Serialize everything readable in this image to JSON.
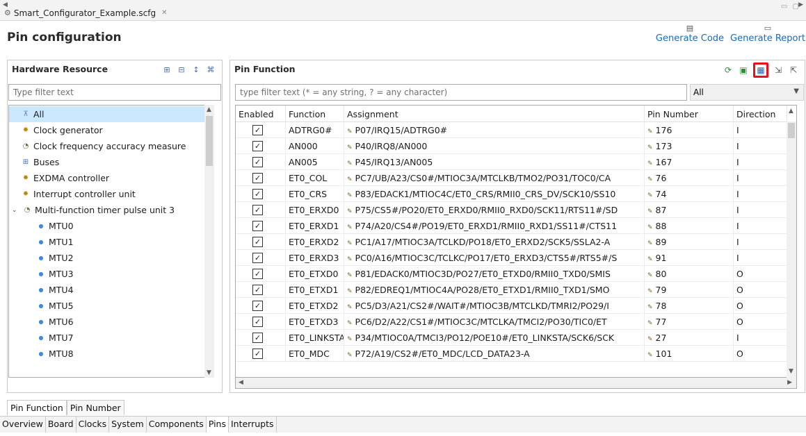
{
  "editor_tab": {
    "title": "Smart_Configurator_Example.scfg",
    "close": "✕"
  },
  "header": {
    "title": "Pin configuration",
    "generate_code": "Generate Code",
    "generate_report": "Generate Report"
  },
  "hardware_resource": {
    "title": "Hardware Resource",
    "filter_placeholder": "Type filter text",
    "items": [
      {
        "label": "All",
        "icon": "all-icon",
        "indent": 0,
        "selected": true
      },
      {
        "label": "Clock generator",
        "icon": "gear-icon",
        "indent": 0
      },
      {
        "label": "Clock frequency accuracy measure",
        "icon": "clock-icon",
        "indent": 0
      },
      {
        "label": "Buses",
        "icon": "bus-icon",
        "indent": 0
      },
      {
        "label": "EXDMA controller",
        "icon": "gear-icon",
        "indent": 0
      },
      {
        "label": "Interrupt controller unit",
        "icon": "gear-icon",
        "indent": 0
      },
      {
        "label": "Multi-function timer pulse unit 3",
        "icon": "clock-icon",
        "indent": 0,
        "expanded": true
      },
      {
        "label": "MTU0",
        "icon": "dot-icon",
        "indent": 1
      },
      {
        "label": "MTU1",
        "icon": "dot-icon",
        "indent": 1
      },
      {
        "label": "MTU2",
        "icon": "dot-icon",
        "indent": 1
      },
      {
        "label": "MTU3",
        "icon": "dot-icon",
        "indent": 1
      },
      {
        "label": "MTU4",
        "icon": "dot-icon",
        "indent": 1
      },
      {
        "label": "MTU5",
        "icon": "dot-icon",
        "indent": 1
      },
      {
        "label": "MTU6",
        "icon": "dot-icon",
        "indent": 1
      },
      {
        "label": "MTU7",
        "icon": "dot-icon",
        "indent": 1
      },
      {
        "label": "MTU8",
        "icon": "dot-icon",
        "indent": 1
      }
    ]
  },
  "pin_function": {
    "title": "Pin Function",
    "filter_placeholder": "type filter text (* = any string, ? = any character)",
    "select_value": "All",
    "columns": [
      "Enabled",
      "Function",
      "Assignment",
      "Pin Number",
      "Direction"
    ],
    "rows": [
      {
        "function": "ADTRG0#",
        "assignment": "P07/IRQ15/ADTRG0#",
        "pin": "176",
        "dir": "I"
      },
      {
        "function": "AN000",
        "assignment": "P40/IRQ8/AN000",
        "pin": "173",
        "dir": "I"
      },
      {
        "function": "AN005",
        "assignment": "P45/IRQ13/AN005",
        "pin": "167",
        "dir": "I"
      },
      {
        "function": "ET0_COL",
        "assignment": "PC7/UB/A23/CS0#/MTIOC3A/MTCLKB/TMO2/PO31/TOC0/CA",
        "pin": "76",
        "dir": "I"
      },
      {
        "function": "ET0_CRS",
        "assignment": "P83/EDACK1/MTIOC4C/ET0_CRS/RMII0_CRS_DV/SCK10/SS10",
        "pin": "74",
        "dir": "I"
      },
      {
        "function": "ET0_ERXD0",
        "assignment": "P75/CS5#/PO20/ET0_ERXD0/RMII0_RXD0/SCK11/RTS11#/SD",
        "pin": "87",
        "dir": "I"
      },
      {
        "function": "ET0_ERXD1",
        "assignment": "P74/A20/CS4#/PO19/ET0_ERXD1/RMII0_RXD1/SS11#/CTS11",
        "pin": "88",
        "dir": "I"
      },
      {
        "function": "ET0_ERXD2",
        "assignment": "PC1/A17/MTIOC3A/TCLKD/PO18/ET0_ERXD2/SCK5/SSLA2-A",
        "pin": "89",
        "dir": "I"
      },
      {
        "function": "ET0_ERXD3",
        "assignment": "PC0/A16/MTIOC3C/TCLKC/PO17/ET0_ERXD3/CTS5#/RTS5#/S",
        "pin": "91",
        "dir": "I"
      },
      {
        "function": "ET0_ETXD0",
        "assignment": "P81/EDACK0/MTIOC3D/PO27/ET0_ETXD0/RMII0_TXD0/SMIS",
        "pin": "80",
        "dir": "O"
      },
      {
        "function": "ET0_ETXD1",
        "assignment": "P82/EDREQ1/MTIOC4A/PO28/ET0_ETXD1/RMII0_TXD1/SMO",
        "pin": "79",
        "dir": "O"
      },
      {
        "function": "ET0_ETXD2",
        "assignment": "PC5/D3/A21/CS2#/WAIT#/MTIOC3B/MTCLKD/TMRI2/PO29/I",
        "pin": "78",
        "dir": "O"
      },
      {
        "function": "ET0_ETXD3",
        "assignment": "PC6/D2/A22/CS1#/MTIOC3C/MTCLKA/TMCI2/PO30/TIC0/ET",
        "pin": "77",
        "dir": "O"
      },
      {
        "function": "ET0_LINKSTA",
        "assignment": "P34/MTIOC0A/TMCI3/PO12/POE10#/ET0_LINKSTA/SCK6/SCK",
        "pin": "27",
        "dir": "I"
      },
      {
        "function": "ET0_MDC",
        "assignment": "P72/A19/CS2#/ET0_MDC/LCD_DATA23-A",
        "pin": "101",
        "dir": "O"
      }
    ]
  },
  "view_tabs": [
    "Pin Function",
    "Pin Number"
  ],
  "page_tabs": [
    "Overview",
    "Board",
    "Clocks",
    "System",
    "Components",
    "Pins",
    "Interrupts"
  ]
}
